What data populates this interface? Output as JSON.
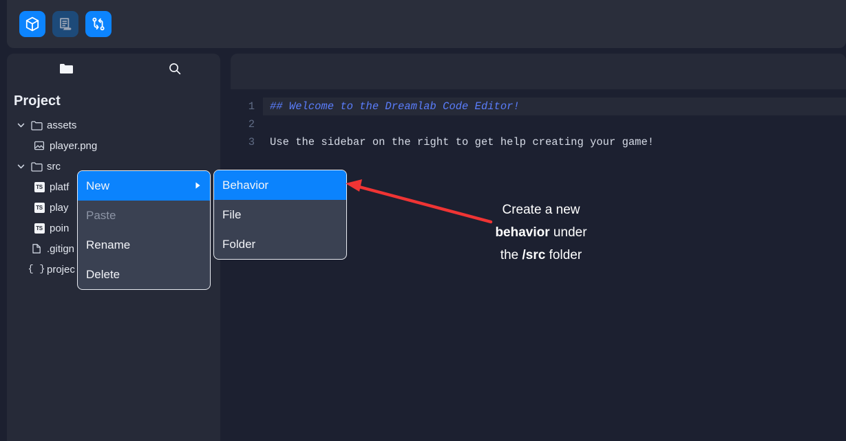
{
  "toolbar": {
    "buttons": [
      {
        "name": "cube-icon",
        "label": "Scene",
        "state": "active",
        "color": "#0c84fe"
      },
      {
        "name": "script-icon",
        "label": "Script",
        "state": "inactive",
        "color": "#1d4a79"
      },
      {
        "name": "git-branch-icon",
        "label": "Version Control",
        "state": "active",
        "color": "#0c84fe"
      }
    ]
  },
  "sidebar": {
    "header": {
      "folder_icon": "folder-icon",
      "search_icon": "search-icon"
    },
    "title": "Project",
    "tree": [
      {
        "label": "assets",
        "type": "folder",
        "expanded": true,
        "indent": 0
      },
      {
        "label": "player.png",
        "type": "image",
        "indent": 1
      },
      {
        "label": "src",
        "type": "folder",
        "expanded": true,
        "indent": 0
      },
      {
        "label": "platf",
        "type": "ts",
        "indent": 1
      },
      {
        "label": "play",
        "type": "ts",
        "indent": 1
      },
      {
        "label": "poin",
        "type": "ts",
        "indent": 1
      },
      {
        "label": ".gitign",
        "type": "file",
        "indent": 1
      },
      {
        "label": "projec",
        "type": "json",
        "indent": 1
      }
    ]
  },
  "editor": {
    "tabs": [],
    "lines": [
      {
        "num": "1",
        "text": "## Welcome to the Dreamlab Code Editor!",
        "style": "md-head",
        "active": true
      },
      {
        "num": "2",
        "text": "",
        "style": "plain",
        "active": false
      },
      {
        "num": "3",
        "text": "Use the sidebar on the right to get help creating your game!",
        "style": "plain",
        "active": false
      }
    ]
  },
  "context_menu": {
    "items": [
      {
        "label": "New",
        "state": "selected",
        "submenu": true
      },
      {
        "label": "Paste",
        "state": "disabled",
        "submenu": false
      },
      {
        "label": "Rename",
        "state": "normal",
        "submenu": false
      },
      {
        "label": "Delete",
        "state": "normal",
        "submenu": false
      }
    ],
    "submenu": {
      "items": [
        {
          "label": "Behavior",
          "state": "selected"
        },
        {
          "label": "File",
          "state": "normal"
        },
        {
          "label": "Folder",
          "state": "normal"
        }
      ]
    }
  },
  "annotation": {
    "line1": "Create a new",
    "line2_bold": "behavior",
    "line2_rest": " under",
    "line3_pre": "the ",
    "line3_bold": "/src",
    "line3_rest": " folder",
    "arrow_color": "#ef3434"
  },
  "colors": {
    "page_bg": "#1c2030",
    "panel_bg": "#262a38",
    "menu_bg": "#3a4152",
    "accent": "#0b83fd",
    "md_heading": "#5a7dfb"
  }
}
